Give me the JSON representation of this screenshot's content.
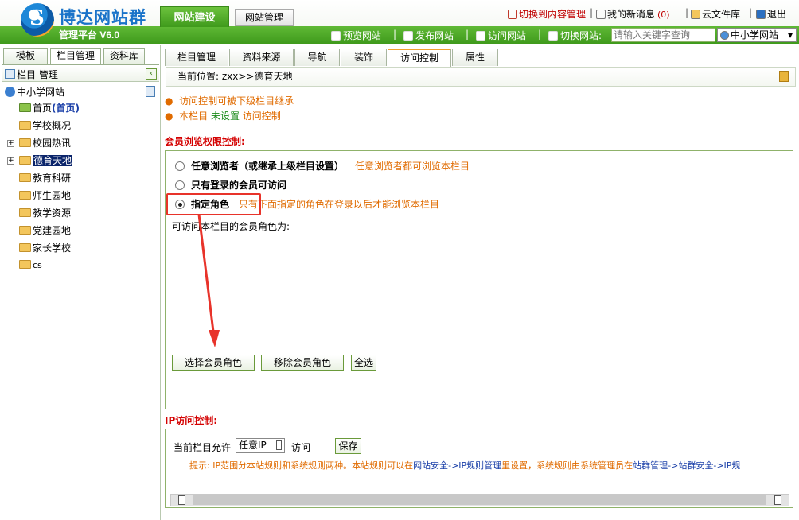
{
  "header": {
    "logo_text": "博达网站群",
    "logo_sub": "管理平台   V6.0",
    "tabs": [
      {
        "label": "网站建设"
      },
      {
        "label": "网站管理"
      }
    ],
    "top_links": [
      {
        "label": "切换到内容管理"
      },
      {
        "label": "我的新消息"
      },
      {
        "label": "(0)"
      },
      {
        "label": "云文件库"
      },
      {
        "label": "退出"
      }
    ],
    "toolbar": [
      {
        "label": "预览网站"
      },
      {
        "label": "发布网站"
      },
      {
        "label": "访问网站"
      },
      {
        "label": "切换网站:"
      }
    ],
    "search_placeholder": "请输入关键字查询",
    "site_select": "中小学网站"
  },
  "left": {
    "tabs": [
      {
        "label": "模板"
      },
      {
        "label": "栏目管理"
      },
      {
        "label": "资料库"
      }
    ],
    "head": "栏目 管理",
    "root": "中小学网站",
    "items": [
      {
        "label": "首页",
        "suffix": "(首页)"
      },
      {
        "label": "学校概况"
      },
      {
        "label": "校园热讯"
      },
      {
        "label": "德育天地"
      },
      {
        "label": "教育科研"
      },
      {
        "label": "师生园地"
      },
      {
        "label": "教学资源"
      },
      {
        "label": "党建园地"
      },
      {
        "label": "家长学校"
      },
      {
        "label": "cs"
      }
    ]
  },
  "right": {
    "tabs": [
      {
        "label": "栏目管理"
      },
      {
        "label": "资料来源"
      },
      {
        "label": "导航"
      },
      {
        "label": "装饰"
      },
      {
        "label": "访问控制"
      },
      {
        "label": "属性"
      }
    ],
    "breadcrumb": "当前位置: zxx>>德育天地",
    "notes": {
      "line1": "访问控制可被下级栏目继承",
      "line2_a": "本栏目",
      "line2_b": "未设置",
      "line2_c": "访问控制"
    },
    "member_title": "会员浏览权限控制:",
    "options": [
      {
        "label": "任意浏览者（或继承上级栏目设置）",
        "hint": "任意浏览者都可浏览本栏目"
      },
      {
        "label": "只有登录的会员可访问",
        "hint": ""
      },
      {
        "label": "指定角色",
        "hint": "只有下面指定的角色在登录以后才能浏览本栏目"
      }
    ],
    "roles_label": "可访问本栏目的会员角色为:",
    "buttons": {
      "select": "选择会员角色",
      "remove": "移除会员角色",
      "all": "全选"
    },
    "ip_title": "IP访问控制:",
    "ip_prefix": "当前栏目允许",
    "ip_select": "任意IP",
    "ip_suffix": "访问",
    "save": "保存",
    "ip_tip_a": "提示: IP范围分本站规则和系统规则两种。本站规则可以在",
    "ip_tip_link1": "网站安全->IP规则管理",
    "ip_tip_b": "里设置，系统规则由系统管理员在",
    "ip_tip_link2": "站群管理->站群安全->IP规"
  }
}
